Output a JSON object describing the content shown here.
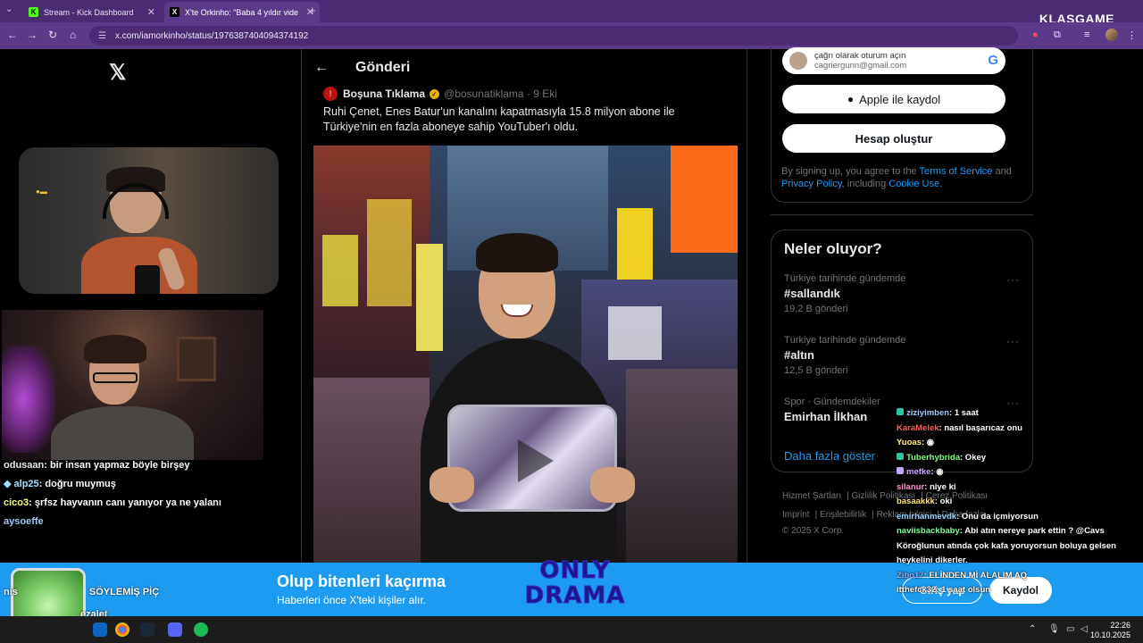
{
  "browser": {
    "tabs": [
      {
        "label": "Stream - Kick Dashboard",
        "active": false
      },
      {
        "label": "X'te Orkinho: \"Baba 4 yıldır vide",
        "active": true
      }
    ],
    "url": "x.com/iamorkinho/status/1976387404094374192",
    "brand": "KLASGAME"
  },
  "post": {
    "header_title": "Gönderi",
    "author_name": "Boşuna Tıklama",
    "author_handle": "@bosunatiklama · 9 Eki",
    "text": "Ruhi Çenet, Enes Batur'un kanalını kapatmasıyla 15.8 milyon abone ile Türkiye'nin en fazla aboneye sahip YouTuber'ı oldu."
  },
  "signup": {
    "google_title": "çağrı olarak oturum açın",
    "google_email": "cagriergunn@gmail.com",
    "apple_label": "Apple ile kaydol",
    "create_label": "Hesap oluştur",
    "terms_prefix": "By signing up, you agree to the ",
    "terms_link": "Terms of Service",
    "terms_and": " and ",
    "privacy_link": "Privacy Policy",
    "terms_including": ", including ",
    "cookie_link": "Cookie Use",
    "terms_end": "."
  },
  "trends": {
    "title": "Neler oluyor?",
    "items": [
      {
        "context": "Türkiye tarihinde gündemde",
        "title": "#sallandık",
        "count": "19,2 B gönderi"
      },
      {
        "context": "Türkiye tarihinde gündemde",
        "title": "#altın",
        "count": "12,5 B gönderi"
      },
      {
        "context": "Spor · Gündemdekiler",
        "title": "Emirhan İlkhan",
        "count": ""
      }
    ],
    "show_more": "Daha fazla göster"
  },
  "footer": {
    "links": [
      "Hizmet Şartları",
      "Gizlilik Politikası",
      "Çerez Politikası",
      "Imprint",
      "Erişilebilirlik",
      "Reklam bilgisi",
      "Daha fazla ···"
    ],
    "copyright": "© 2025 X Corp."
  },
  "banner": {
    "title": "Olup bitenleri kaçırma",
    "subtitle": "Haberleri önce X'teki kişiler alır.",
    "login": "Giriş yap",
    "register": "Kaydol",
    "logo_line1": "ONLY",
    "logo_line2": "DRAMA"
  },
  "chat_left": [
    {
      "user": "odusaan",
      "msg": ": bir insan yapmaz böyle birşey"
    },
    {
      "user": "alp25",
      "msg": ": doğru muymuş"
    },
    {
      "user": "cico3",
      "msg": ": şrfsz hayvanın canı yanıyor ya ne yalanı"
    },
    {
      "user": "aysoeffe",
      "msg": ""
    }
  ],
  "chat_left_bottom": {
    "line1": "nis",
    "line1b": "SÖYLEMİŞ PİÇ",
    "line2": "ezalet"
  },
  "chat_right": [
    {
      "user": "ziziyimben",
      "msg": ": 1 saat",
      "color": "#a0c8ff"
    },
    {
      "user": "KaraMelek",
      "msg": ": nasıl başarıcaz onu",
      "color": "#ff5c5c"
    },
    {
      "user": "Yuoas",
      "msg": ":",
      "color": "#fff07a"
    },
    {
      "user": "Tuberhybrida",
      "msg": ": Okey",
      "color": "#7cff7a"
    },
    {
      "user": "mefke",
      "msg": ":",
      "color": "#c6a8ff"
    },
    {
      "user": "silanur",
      "msg": ": niye ki",
      "color": "#ff9bd1"
    },
    {
      "user": "basaakkk",
      "msg": ": oki",
      "color": "#ffe37a"
    },
    {
      "user": "emirhanmevdk",
      "msg": ": Onu da içmiyorsun",
      "color": "#9bd3ff"
    },
    {
      "user": "naviisbackbaby",
      "msg": ": Abi atın nereye park ettin ? @Cavs",
      "color": "#7dff9b"
    },
    {
      "user": "",
      "msg": "Köroğlunun atında çok kafa yoruyorsun boluya gelsen heykelini dikerler.",
      "color": "#fff"
    },
    {
      "user": "Zibo17",
      "msg": ": ELİNDEN Mİ ALALIM AQ",
      "color": "#8fb8ff"
    },
    {
      "user": "itthefck32",
      "msg": ": 1 saat olsun",
      "color": "#ffffff"
    }
  ],
  "taskbar": {
    "time": "22:26",
    "date": "10.10.2025"
  }
}
